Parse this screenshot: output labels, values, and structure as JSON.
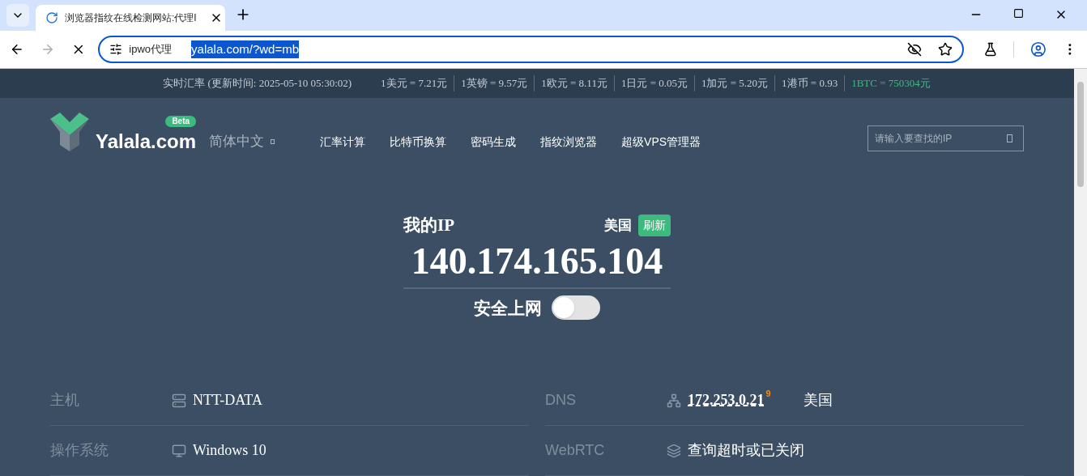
{
  "browser": {
    "tab": {
      "title": "浏览器指纹在线检测网站:代理I",
      "loading": true
    },
    "address": {
      "chip": "ipwo代理",
      "url": "yalala.com/?wd=mb",
      "selected": true
    }
  },
  "ticker": {
    "label": "实时汇率 (更新时间: 2025-05-10 05:30:02)",
    "rates": [
      {
        "text": "1美元 = 7.21元",
        "highlight": false
      },
      {
        "text": "1英镑 = 9.57元",
        "highlight": false
      },
      {
        "text": "1欧元 = 8.11元",
        "highlight": false
      },
      {
        "text": "1日元 = 0.05元",
        "highlight": false
      },
      {
        "text": "1加元 = 5.20元",
        "highlight": false
      },
      {
        "text": "1港币 = 0.93",
        "highlight": false
      },
      {
        "text": "1BTC = 750304元",
        "highlight": true
      }
    ]
  },
  "nav": {
    "logo": "Yalala.com",
    "badge": "Beta",
    "language": "简体中文",
    "items": [
      "汇率计算",
      "比特币换算",
      "密码生成",
      "指纹浏览器",
      "超级VPS管理器"
    ],
    "search": {
      "placeholder": "请输入要查找的IP"
    }
  },
  "hero": {
    "label": "我的IP",
    "country": "美国",
    "refresh": "刷新",
    "ip": "140.174.165.104",
    "secure": {
      "label": "安全上网",
      "on": false
    }
  },
  "info": [
    {
      "label": "主机",
      "kind": "server",
      "value": "NTT-DATA"
    },
    {
      "label": "DNS",
      "kind": "network",
      "value": "172.253.0.21",
      "count": "9",
      "country": "美国"
    },
    {
      "label": "操作系统",
      "kind": "monitor",
      "value": "Windows 10"
    },
    {
      "label": "WebRTC",
      "kind": "layers",
      "value": "查询超时或已关闭"
    }
  ]
}
